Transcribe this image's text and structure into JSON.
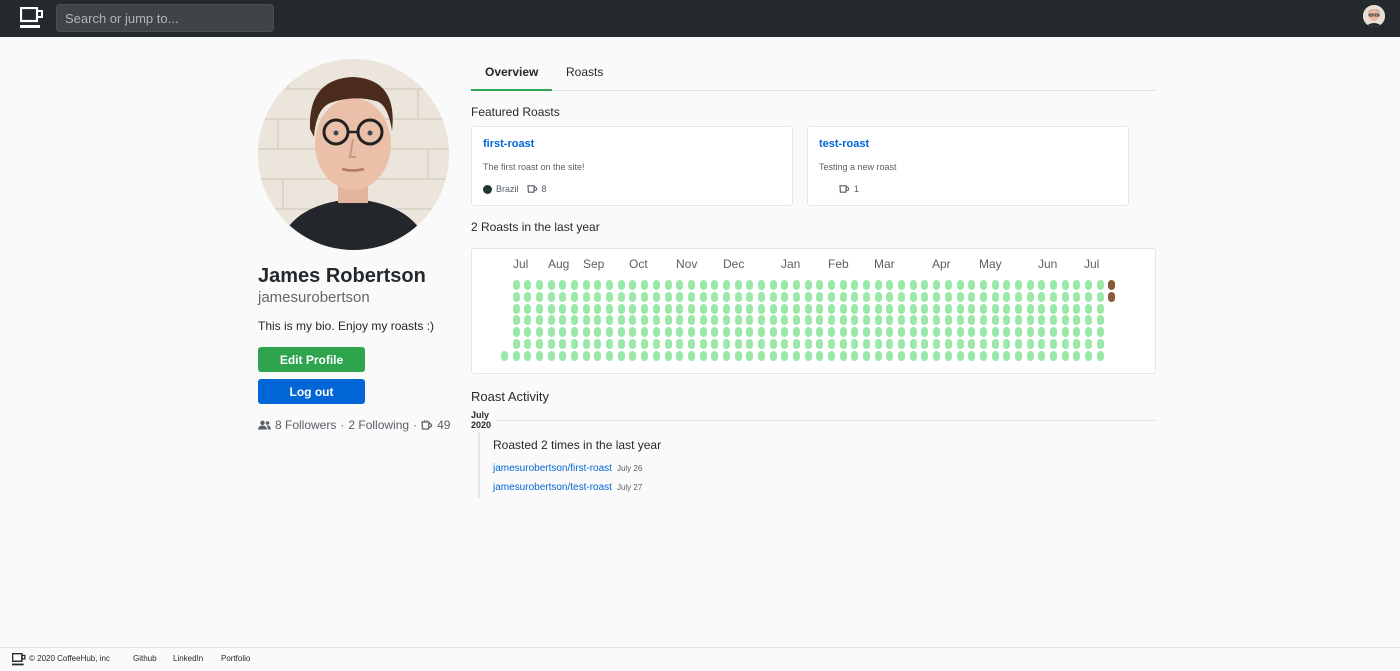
{
  "header": {
    "search_placeholder": "Search or jump to..."
  },
  "profile": {
    "name": "James Robertson",
    "username": "jamesurobertson",
    "bio": "This is my bio. Enjoy my roasts :)",
    "edit_label": "Edit Profile",
    "logout_label": "Log out",
    "followers": "8 Followers",
    "following": "2 Following",
    "separator": "·",
    "cups": "49"
  },
  "tabs": [
    {
      "label": "Overview",
      "active": true
    },
    {
      "label": "Roasts",
      "active": false
    }
  ],
  "featured": {
    "title": "Featured Roasts",
    "cards": [
      {
        "name": "first-roast",
        "description": "The first roast on the site!",
        "origin": "Brazil",
        "cups": "8"
      },
      {
        "name": "test-roast",
        "description": "Testing a new roast",
        "origin": "",
        "cups": "1"
      }
    ]
  },
  "heatmap": {
    "title": "2 Roasts in the last year",
    "months": [
      "Jul",
      "Aug",
      "Sep",
      "Oct",
      "Nov",
      "Dec",
      "Jan",
      "Feb",
      "Mar",
      "Apr",
      "May",
      "Jun",
      "Jul"
    ],
    "active_days": [
      "July 26",
      "July 27"
    ],
    "colors": {
      "empty": "#9be9a8",
      "roast": "#8b5a3c"
    }
  },
  "activity": {
    "title": "Roast Activity",
    "month": "July",
    "year": "2020",
    "summary": "Roasted 2 times in the last year",
    "items": [
      {
        "repo": "jamesurobertson/first-roast",
        "date": "July 26"
      },
      {
        "repo": "jamesurobertson/test-roast",
        "date": "July 27"
      }
    ]
  },
  "footer": {
    "copyright": "© 2020 CoffeeHub, inc",
    "links": [
      "Github",
      "LinkedIn",
      "Portfolio"
    ]
  }
}
